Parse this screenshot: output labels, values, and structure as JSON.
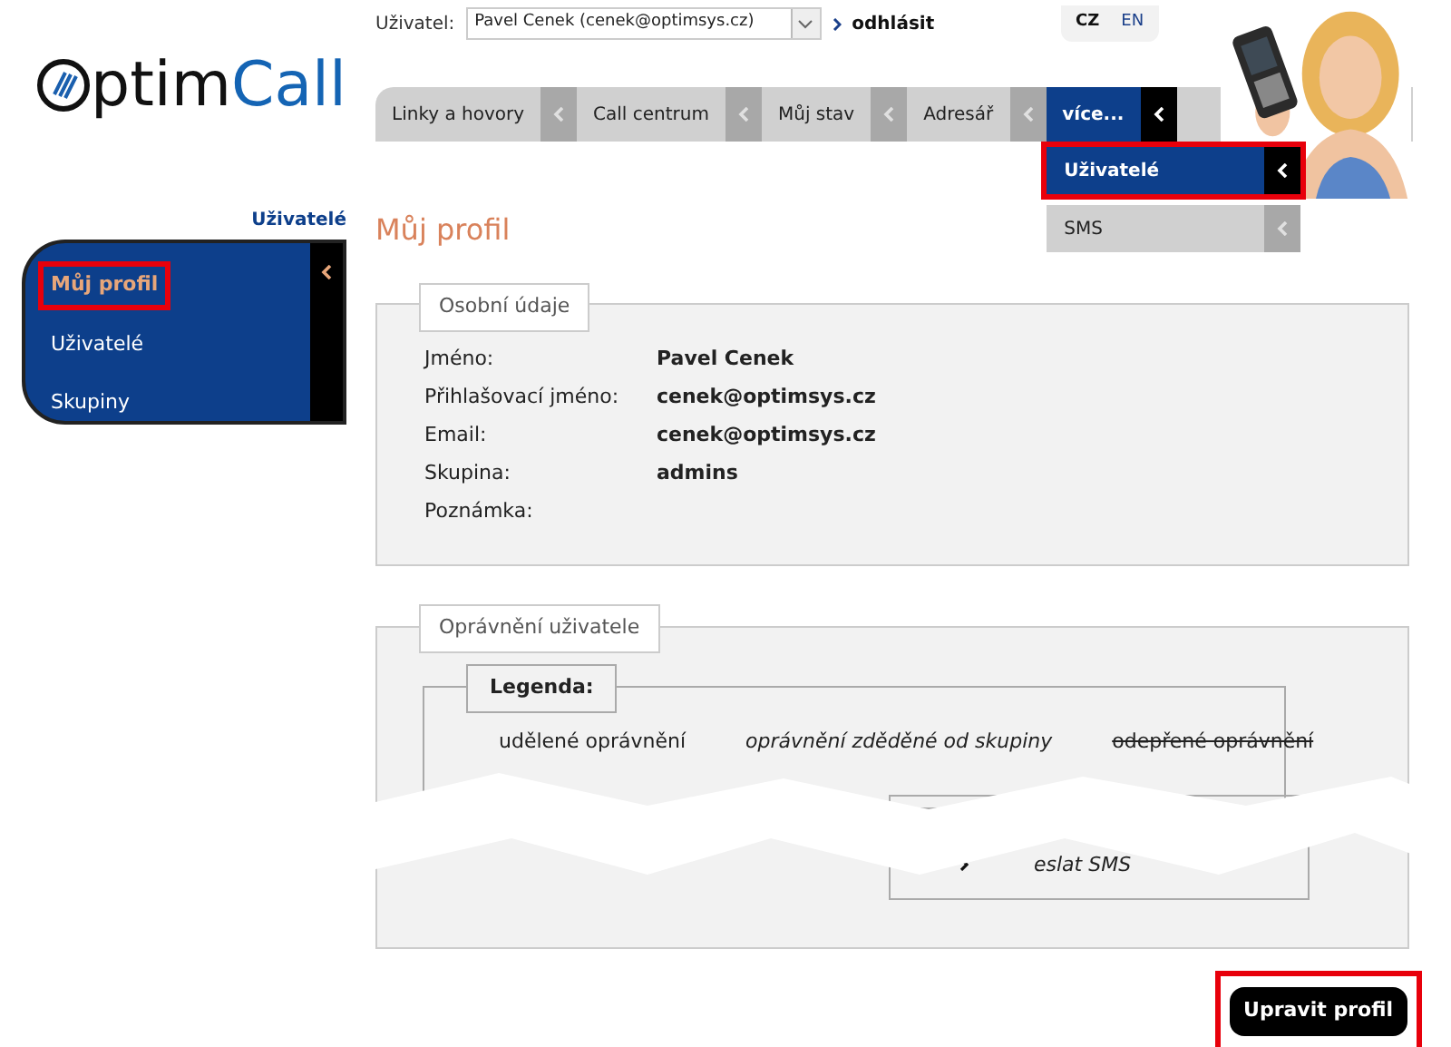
{
  "header": {
    "user_label": "Uživatel:",
    "user_select": {
      "value": "Pavel Cenek (cenek@optimsys.cz)"
    },
    "logout": "odhlásit",
    "languages": [
      {
        "label": "CZ",
        "selected": true
      },
      {
        "label": "EN",
        "selected": false
      }
    ]
  },
  "logo": {
    "text_dark": "ptim",
    "text_blue": "Call"
  },
  "nav": {
    "tabs": [
      {
        "label": "Linky a hovory",
        "selected": false
      },
      {
        "label": "Call centrum",
        "selected": false
      },
      {
        "label": "Můj stav",
        "selected": false
      },
      {
        "label": "Adresář",
        "selected": false
      },
      {
        "label": "více...",
        "selected": true
      }
    ],
    "dropdown": [
      {
        "label": "Uživatelé",
        "selected": true,
        "highlighted": true
      },
      {
        "label": "SMS",
        "selected": false,
        "highlighted": false
      }
    ]
  },
  "sidebar": {
    "heading": "Uživatelé",
    "items": [
      {
        "label": "Můj profil",
        "selected": true,
        "highlighted": true
      },
      {
        "label": "Uživatelé",
        "selected": false,
        "highlighted": false
      },
      {
        "label": "Skupiny",
        "selected": false,
        "highlighted": false
      }
    ]
  },
  "page_title": "Můj profil",
  "personal": {
    "legend": "Osobní údaje",
    "rows": [
      {
        "label": "Jméno:",
        "value": "Pavel Cenek"
      },
      {
        "label": "Přihlašovací jméno:",
        "value": "cenek@optimsys.cz"
      },
      {
        "label": "Email:",
        "value": "cenek@optimsys.cz"
      },
      {
        "label": "Skupina:",
        "value": "admins"
      },
      {
        "label": "Poznámka:"
      }
    ]
  },
  "permissions": {
    "legend": "Oprávnění uživatele",
    "key": {
      "legend": "Legenda:",
      "items": [
        {
          "label": "udělené oprávnění",
          "kind": "granted"
        },
        {
          "label": "oprávnění zděděné od skupiny",
          "kind": "inherited"
        },
        {
          "label": "odepřené oprávnění",
          "kind": "denied"
        }
      ]
    },
    "visible_items": [
      {
        "label": "eslat SMS",
        "kind": "inherited"
      }
    ]
  },
  "edit_button": {
    "label": "Upravit profil",
    "highlighted": true
  }
}
